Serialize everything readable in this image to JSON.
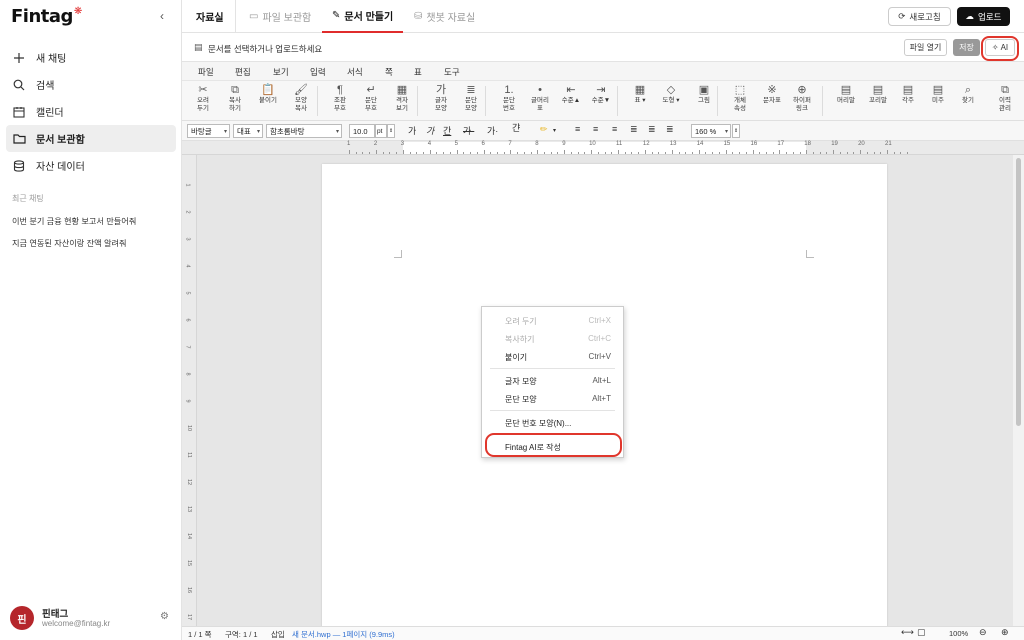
{
  "sidebar": {
    "logo": "Fintag",
    "nav": [
      {
        "label": "새 채팅",
        "icon": "plus-icon"
      },
      {
        "label": "검색",
        "icon": "search-icon"
      },
      {
        "label": "캘린더",
        "icon": "calendar-icon"
      },
      {
        "label": "문서 보관함",
        "icon": "folder-icon",
        "active": true
      },
      {
        "label": "자산 데이터",
        "icon": "database-icon"
      }
    ],
    "recent_title": "최근 채팅",
    "recent": [
      "이번 분기 금융 현황 보고서 만들어줘",
      "지금 연동된 자산이랑 잔액 알려줘"
    ],
    "profile": {
      "initial": "핀",
      "name": "핀태그",
      "email": "welcome@fintag.kr"
    }
  },
  "tabs": {
    "main": "자료실",
    "items": [
      "파일 보관함",
      "문서 만들기",
      "챗봇 자료실"
    ],
    "refresh": "새로고침",
    "upload": "업로드"
  },
  "doc": {
    "message": "문서를 선택하거나 업로드하세요",
    "open": "파일 열기",
    "save": "저장",
    "ai": "AI"
  },
  "menus": [
    "파일",
    "편집",
    "보기",
    "입력",
    "서식",
    "쪽",
    "표",
    "도구"
  ],
  "toolbar": [
    {
      "l1": "오려",
      "l2": "두기",
      "g": "✂"
    },
    {
      "l1": "복사",
      "l2": "하기",
      "g": "⧉"
    },
    {
      "l1": "붙이기",
      "l2": "",
      "g": "📋"
    },
    {
      "l1": "모양",
      "l2": "복사",
      "g": "🖌"
    },
    {
      "l1": "조판",
      "l2": "부호",
      "g": "¶"
    },
    {
      "l1": "문단",
      "l2": "부호",
      "g": "↵"
    },
    {
      "l1": "격자",
      "l2": "보기",
      "g": "▦"
    },
    {
      "l1": "글자",
      "l2": "모양",
      "g": "가"
    },
    {
      "l1": "문단",
      "l2": "모양",
      "g": "≣"
    },
    {
      "l1": "문단",
      "l2": "번호",
      "g": "1."
    },
    {
      "l1": "글머리",
      "l2": "표",
      "g": "•"
    },
    {
      "l1": "수준▲",
      "l2": "",
      "g": "⇤"
    },
    {
      "l1": "수준▼",
      "l2": "",
      "g": "⇥"
    },
    {
      "l1": "표 ▾",
      "l2": "",
      "g": "▦"
    },
    {
      "l1": "도형 ▾",
      "l2": "",
      "g": "◇"
    },
    {
      "l1": "그림",
      "l2": "",
      "g": "▣"
    },
    {
      "l1": "개체",
      "l2": "속성",
      "g": "⬚"
    },
    {
      "l1": "문자표",
      "l2": "",
      "g": "※"
    },
    {
      "l1": "하이퍼",
      "l2": "링크",
      "g": "⊕"
    },
    {
      "l1": "머리말",
      "l2": "",
      "g": "▤"
    },
    {
      "l1": "꼬리말",
      "l2": "",
      "g": "▤"
    },
    {
      "l1": "각주",
      "l2": "",
      "g": "▤"
    },
    {
      "l1": "미주",
      "l2": "",
      "g": "▤"
    },
    {
      "l1": "찾기",
      "l2": "",
      "g": "⌕"
    },
    {
      "l1": "이력",
      "l2": "관리",
      "g": "⧉"
    }
  ],
  "format": {
    "style": "바탕글",
    "lang": "대표",
    "font": "함초롬바탕",
    "size": "10.0",
    "unit": "pt",
    "zoom": "160 %"
  },
  "ruler_numbers": [
    "1",
    "2",
    "3",
    "4",
    "5",
    "6",
    "7",
    "8",
    "9",
    "10",
    "11",
    "12",
    "13",
    "14",
    "15",
    "16",
    "17",
    "18",
    "19",
    "20",
    "21"
  ],
  "context_menu": {
    "items": [
      {
        "label": "오려 두기",
        "shortcut": "Ctrl+X"
      },
      {
        "label": "복사하기",
        "shortcut": "Ctrl+C"
      },
      {
        "label": "붙이기",
        "shortcut": "Ctrl+V"
      },
      {
        "label": "글자 모양",
        "shortcut": "Alt+L"
      },
      {
        "label": "문단 모양",
        "shortcut": "Alt+T"
      },
      {
        "label": "문단 번호 모양(N)...",
        "shortcut": ""
      },
      {
        "label": "Fintag AI로 작성",
        "shortcut": ""
      }
    ]
  },
  "status": {
    "page": "1 / 1 쪽",
    "section": "구역: 1 / 1",
    "mode": "삽입",
    "file": "새 문서.hwp — 1페이지 (9.9ms)",
    "zoom": "100%"
  }
}
